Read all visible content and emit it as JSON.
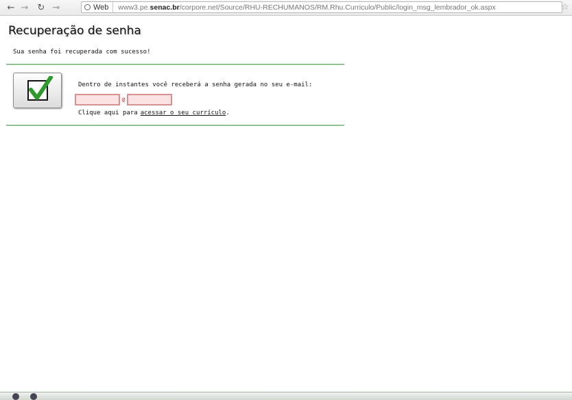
{
  "browser": {
    "back_icon": "back-arrow-icon",
    "forward_icon": "forward-arrow-icon",
    "reload_icon": "reload-icon",
    "key_icon": "key-icon",
    "site_chip_label": "Web",
    "url_prefix": "www3.pe.",
    "url_domain": "senac.br",
    "url_path": "/corpore.net/Source/RHU-RECHUMANOS/RM.Rhu.Curriculo/Public/login_msg_lembrador_ok.aspx",
    "star_icon": "bookmark-star-icon"
  },
  "page": {
    "title": "Recuperação de senha",
    "success_message": "Sua senha foi recuperada com sucesso!",
    "instruction": "Dentro de instantes você receberá a senha gerada no seu e-mail:",
    "email_user_value": "",
    "email_at": "@",
    "email_domain_value": "",
    "link_prefix": "Clique aqui para",
    "link_text": "acessar o seu currículo",
    "link_suffix": "."
  },
  "colors": {
    "rule": "#8fc38f",
    "check": "#2e9a2e",
    "field_border": "#d79090",
    "field_bg": "#fbe3e3"
  }
}
